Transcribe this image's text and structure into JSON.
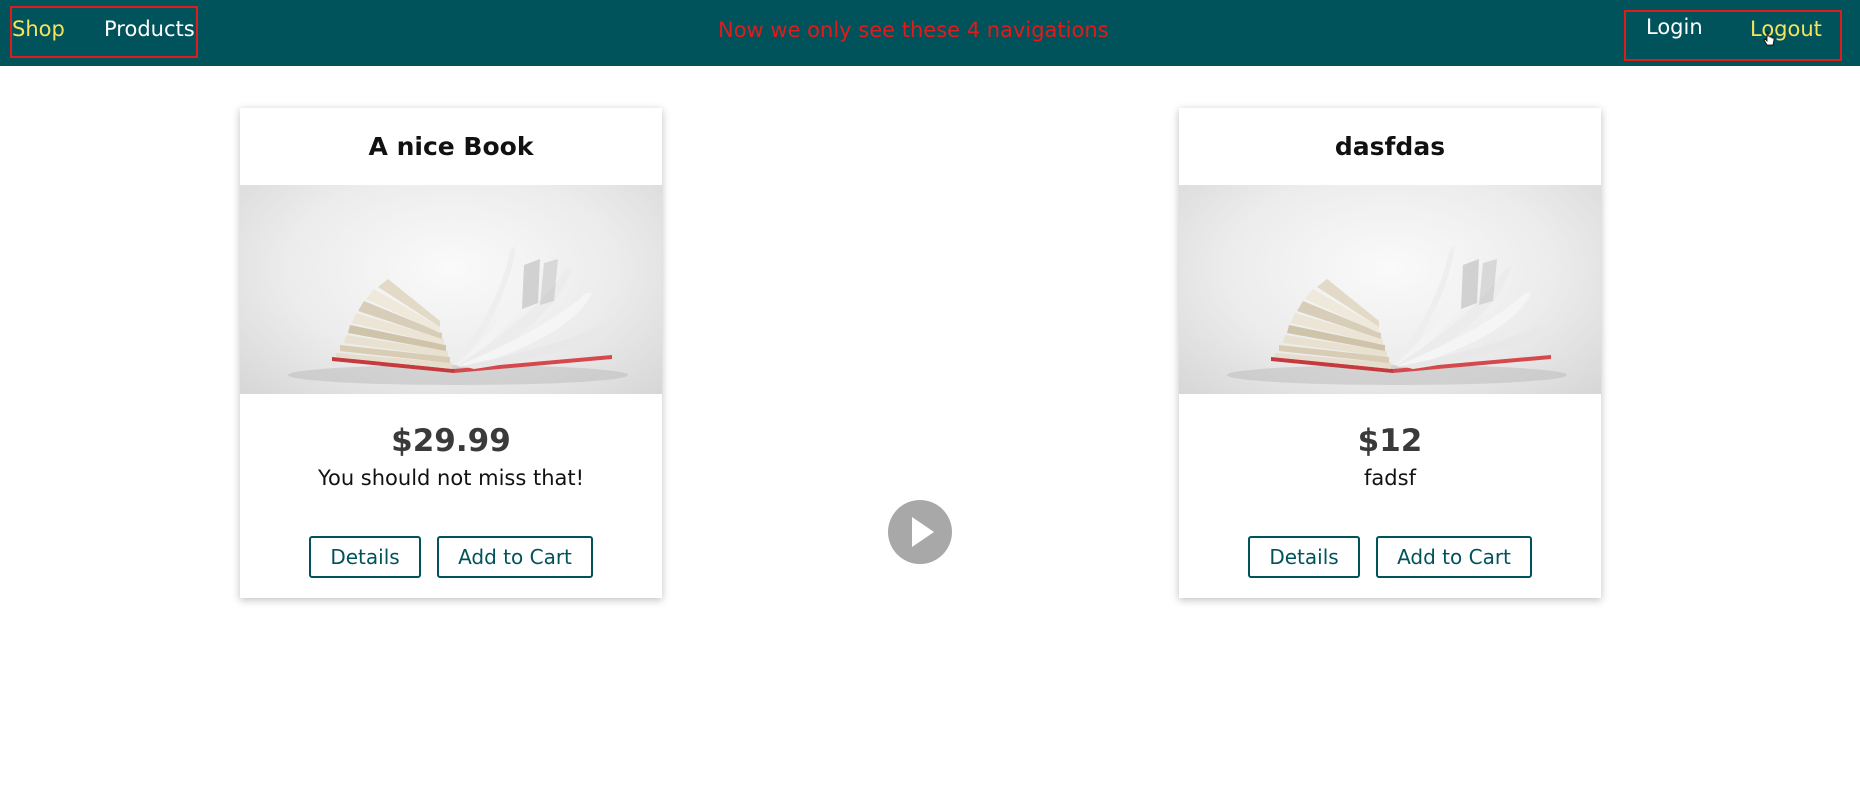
{
  "header": {
    "nav_left": [
      {
        "label": "Shop",
        "active": true
      },
      {
        "label": "Products",
        "active": false
      }
    ],
    "nav_right": [
      {
        "label": "Login",
        "active": false
      },
      {
        "label": "Logout",
        "active": true
      }
    ],
    "annotation": "Now we only see these 4 navigations"
  },
  "products": [
    {
      "title": "A nice Book",
      "price": "$29.99",
      "description": "You should not miss that!",
      "details_label": "Details",
      "cart_label": "Add to Cart"
    },
    {
      "title": "dasfdas",
      "price": "$12",
      "description": "fadsf",
      "details_label": "Details",
      "cart_label": "Add to Cart"
    }
  ],
  "colors": {
    "header_bg": "#00535a",
    "active_link": "#f5e35e",
    "annotation": "#e01b1b",
    "button_border": "#00535a"
  },
  "icons": {
    "play": "play-icon",
    "cursor": "pointer-cursor-icon",
    "book": "open-book-image"
  }
}
